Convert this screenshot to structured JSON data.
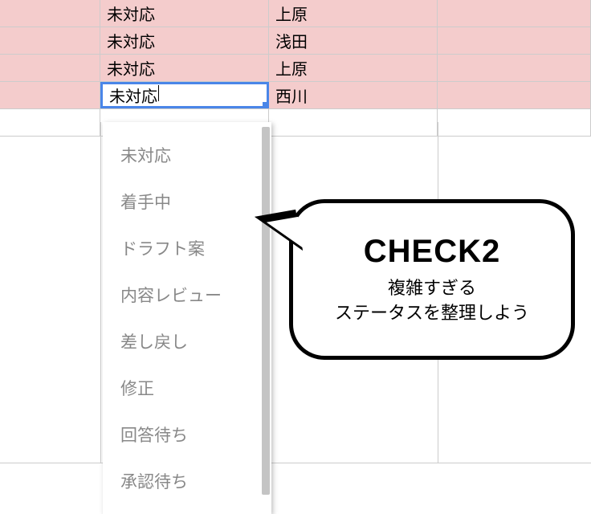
{
  "table": {
    "rows": [
      {
        "status": "未対応",
        "name": "上原"
      },
      {
        "status": "未対応",
        "name": "浅田"
      },
      {
        "status": "未対応",
        "name": "上原"
      },
      {
        "status": "未対応",
        "name": "西川"
      }
    ]
  },
  "dropdown": {
    "options": [
      "未対応",
      "着手中",
      "ドラフト案",
      "内容レビュー",
      "差し戻し",
      "修正",
      "回答待ち",
      "承認待ち"
    ]
  },
  "bubble": {
    "title": "CHECK2",
    "line1": "複雑すぎる",
    "line2": "ステータスを整理しよう"
  }
}
